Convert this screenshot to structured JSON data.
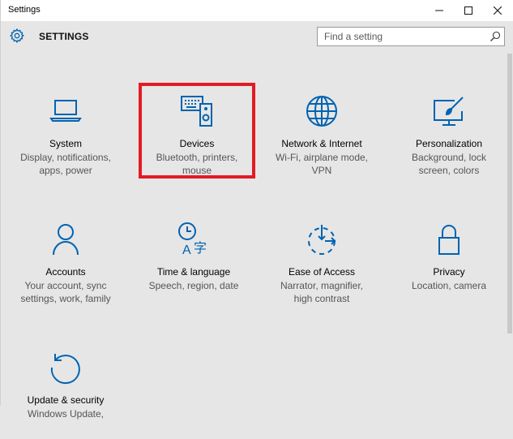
{
  "window": {
    "title": "Settings",
    "minimize_label": "—",
    "maximize_label": "☐",
    "close_label": "✕"
  },
  "header": {
    "icon": "gear-icon",
    "title": "SETTINGS",
    "search_placeholder": "Find a setting"
  },
  "accent_color": "#0063b1",
  "highlight_color": "#e21b23",
  "tiles": [
    {
      "icon": "laptop-icon",
      "title": "System",
      "line1": "Display, notifications,",
      "line2": "apps, power"
    },
    {
      "icon": "devices-icon",
      "title": "Devices",
      "line1": "Bluetooth, printers,",
      "line2": "mouse"
    },
    {
      "icon": "globe-icon",
      "title": "Network & Internet",
      "line1": "Wi-Fi, airplane mode,",
      "line2": "VPN"
    },
    {
      "icon": "personalization-icon",
      "title": "Personalization",
      "line1": "Background, lock",
      "line2": "screen, colors"
    },
    {
      "icon": "person-icon",
      "title": "Accounts",
      "line1": "Your account, sync",
      "line2": "settings, work, family"
    },
    {
      "icon": "time-language-icon",
      "title": "Time & language",
      "line1": "Speech, region, date",
      "line2": ""
    },
    {
      "icon": "ease-of-access-icon",
      "title": "Ease of Access",
      "line1": "Narrator, magnifier,",
      "line2": "high contrast"
    },
    {
      "icon": "lock-icon",
      "title": "Privacy",
      "line1": "Location, camera",
      "line2": ""
    },
    {
      "icon": "update-icon",
      "title": "Update & security",
      "line1": "Windows Update,",
      "line2": ""
    }
  ]
}
